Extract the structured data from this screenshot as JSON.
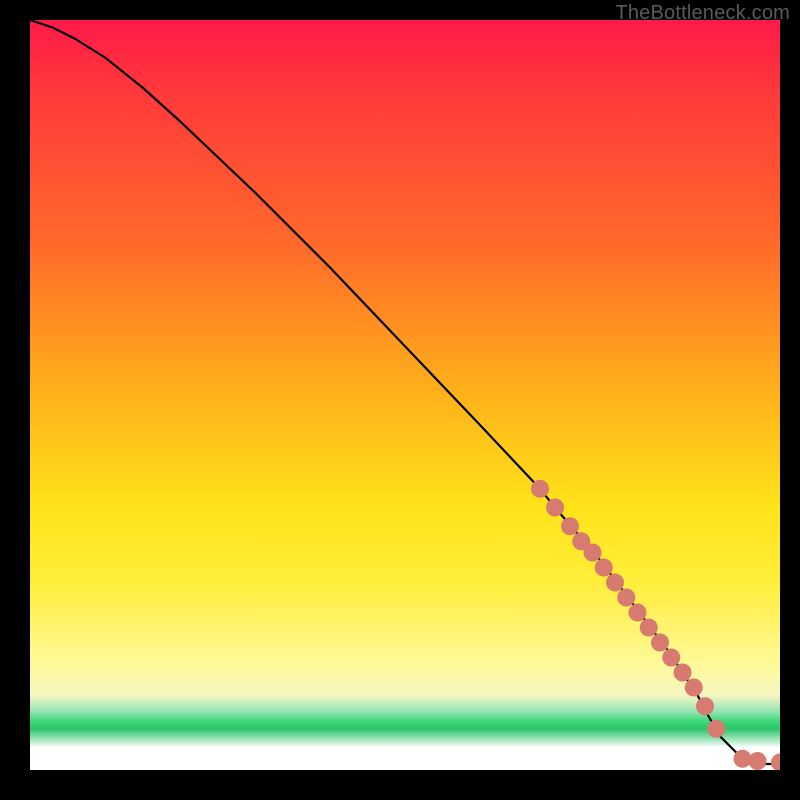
{
  "attribution": "TheBottleneck.com",
  "chart_data": {
    "type": "line",
    "title": "",
    "xlabel": "",
    "ylabel": "",
    "xlim": [
      0,
      100
    ],
    "ylim": [
      0,
      100
    ],
    "series": [
      {
        "name": "curve",
        "x": [
          0,
          3,
          6,
          10,
          15,
          20,
          30,
          40,
          50,
          60,
          68,
          70,
          73,
          76,
          79,
          82,
          85,
          87,
          89,
          90,
          92,
          95,
          98,
          100
        ],
        "y": [
          100,
          99,
          97.5,
          95,
          91,
          86.5,
          77,
          67,
          56.5,
          46,
          37.5,
          35,
          31.5,
          28,
          24,
          20,
          16,
          13,
          10,
          8,
          4.5,
          1.5,
          0.8,
          0.8
        ]
      }
    ],
    "markers": {
      "name": "points",
      "color": "#d77a6f",
      "radius": 9,
      "x": [
        68,
        70,
        72,
        73.5,
        75,
        76.5,
        78,
        79.5,
        81,
        82.5,
        84,
        85.5,
        87,
        88.5,
        90,
        91.5,
        95,
        97,
        100
      ],
      "y": [
        37.5,
        35,
        32.5,
        30.5,
        29,
        27,
        25,
        23,
        21,
        19,
        17,
        15,
        13,
        11,
        8.5,
        5.5,
        1.5,
        1.2,
        1.0
      ]
    }
  }
}
